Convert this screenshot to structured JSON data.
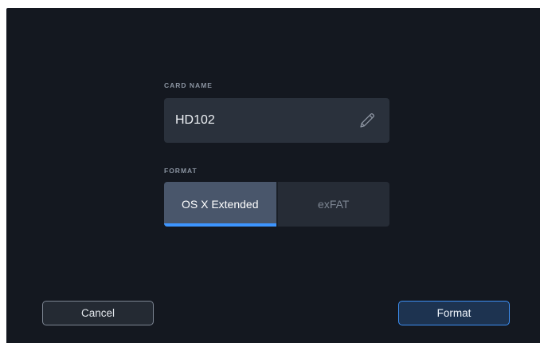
{
  "card_name": {
    "label": "CARD NAME",
    "value": "HD102",
    "edit_icon": "pencil-icon"
  },
  "format": {
    "label": "FORMAT",
    "options": [
      "OS X Extended",
      "exFAT"
    ],
    "selected": "OS X Extended"
  },
  "buttons": {
    "cancel_label": "Cancel",
    "format_label": "Format"
  },
  "colors": {
    "background": "#141820",
    "field_bg": "#2a313c",
    "selected_segment": "#49566b",
    "accent_blue": "#3d95ff",
    "format_button_bg": "#1d3350"
  }
}
